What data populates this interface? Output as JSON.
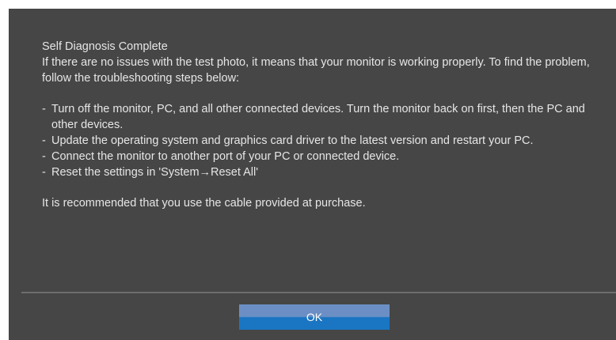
{
  "dialog": {
    "title": "Self Diagnosis Complete",
    "message": "If there are no issues with the test photo, it means that your monitor is working properly. To find the problem, follow the troubleshooting steps below:",
    "steps": [
      "Turn off the monitor, PC, and all other connected devices. Turn the monitor back on first, then the PC and other devices.",
      "Update the operating system and graphics card driver to the latest version and restart your PC.",
      "Connect the monitor to another port of your PC or connected device.",
      "Reset the settings in 'System→Reset All'"
    ],
    "step_prefix": "-",
    "recommendation": "It is recommended that you use the cable provided at purchase.",
    "ok_label": "OK"
  },
  "colors": {
    "dialog_background": "#464646",
    "text": "#e6e6e6",
    "button_top": "#6b8fc4",
    "button_bottom": "#1a75c2"
  }
}
